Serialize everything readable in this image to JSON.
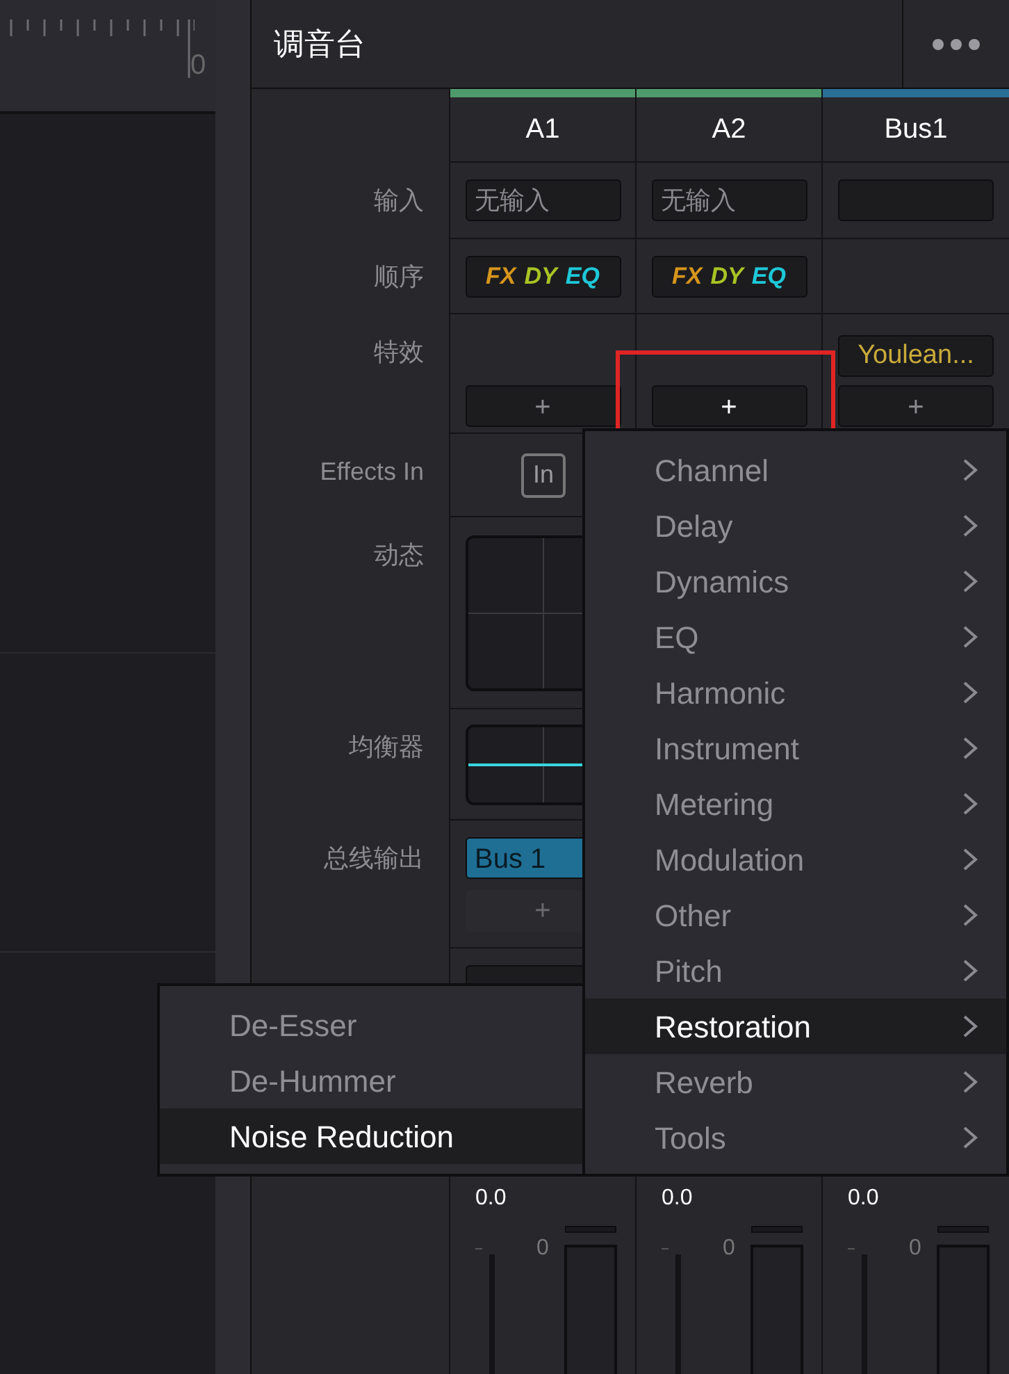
{
  "ruler": {
    "label": "0"
  },
  "panel": {
    "title": "调音台"
  },
  "row_labels": [
    "输入",
    "顺序",
    "特效",
    "Effects In",
    "动态",
    "均衡器",
    "总线输出"
  ],
  "channels": [
    {
      "name": "A1",
      "color": "#4f9a6c",
      "input": "无输入",
      "order_tags": [
        {
          "label": "FX",
          "color": "#d6951c"
        },
        {
          "label": "DY",
          "color": "#a8c424"
        },
        {
          "label": "EQ",
          "color": "#1ec8d8"
        }
      ],
      "add_effect": "+",
      "effects_in": "In",
      "bus_output": "Bus 1",
      "add_bus": "+",
      "reading": "0.0",
      "scale": "0"
    },
    {
      "name": "A2",
      "color": "#4f9a6c",
      "input": "无输入",
      "order_tags": [
        {
          "label": "FX",
          "color": "#d6951c"
        },
        {
          "label": "DY",
          "color": "#a8c424"
        },
        {
          "label": "EQ",
          "color": "#1ec8d8"
        }
      ],
      "add_effect": "+",
      "reading": "0.0",
      "scale": "0"
    },
    {
      "name": "Bus1",
      "color": "#2a6f95",
      "effects": [
        "Youlean..."
      ],
      "add_effect": "+",
      "reading": "0.0",
      "scale": "0"
    }
  ],
  "menu": {
    "items": [
      {
        "label": "Channel",
        "selected": false
      },
      {
        "label": "Delay",
        "selected": false
      },
      {
        "label": "Dynamics",
        "selected": false
      },
      {
        "label": "EQ",
        "selected": false
      },
      {
        "label": "Harmonic",
        "selected": false
      },
      {
        "label": "Instrument",
        "selected": false
      },
      {
        "label": "Metering",
        "selected": false
      },
      {
        "label": "Modulation",
        "selected": false
      },
      {
        "label": "Other",
        "selected": false
      },
      {
        "label": "Pitch",
        "selected": false
      },
      {
        "label": "Restoration",
        "selected": true
      },
      {
        "label": "Reverb",
        "selected": false
      },
      {
        "label": "Tools",
        "selected": false
      }
    ]
  },
  "submenu": {
    "items": [
      {
        "label": "De-Esser",
        "selected": false
      },
      {
        "label": "De-Hummer",
        "selected": false
      },
      {
        "label": "Noise Reduction",
        "selected": true
      }
    ]
  }
}
